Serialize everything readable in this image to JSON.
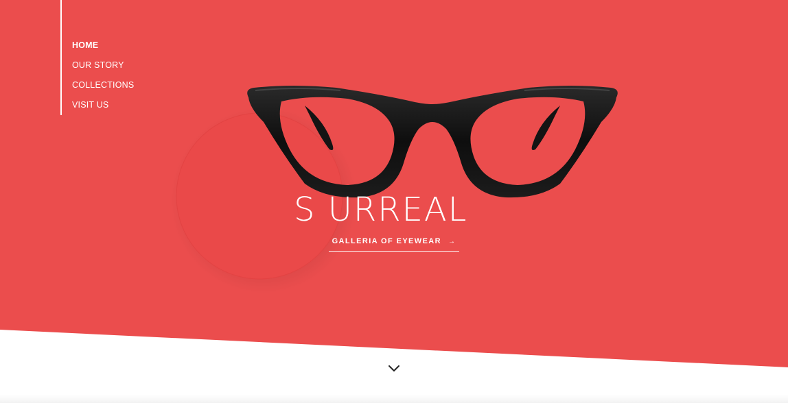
{
  "colors": {
    "hero_red": "#EB4D4D",
    "white": "#FFFFFF",
    "frame_black": "#111111"
  },
  "nav": {
    "items": [
      {
        "label": "HOME",
        "active": true
      },
      {
        "label": "OUR STORY",
        "active": false
      },
      {
        "label": "COLLECTIONS",
        "active": false
      },
      {
        "label": "VISIT US",
        "active": false
      }
    ]
  },
  "hero": {
    "brand": "S URREAL",
    "tagline": "GALLERIA OF EYEWEAR",
    "tagline_icon": "arrow-right-icon",
    "product_image": "cat-eye-glasses",
    "scroll_icon": "chevron-down-icon"
  }
}
